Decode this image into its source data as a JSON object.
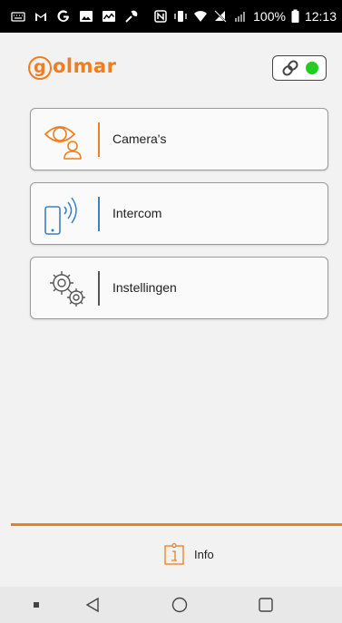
{
  "status_bar": {
    "battery_percent": "100%",
    "time": "12:13"
  },
  "header": {
    "logo_text": "olmar",
    "logo_initial": "g",
    "connection_status": "connected",
    "connection_color": "#22cc22"
  },
  "menu": {
    "items": [
      {
        "label": "Camera's",
        "icon": "camera-eye-user-icon",
        "accent": "#f07d1e"
      },
      {
        "label": "Intercom",
        "icon": "phone-signal-icon",
        "accent": "#3a7fc8"
      },
      {
        "label": "Instellingen",
        "icon": "gears-icon",
        "accent": "#555555"
      }
    ]
  },
  "footer": {
    "info_label": "Info",
    "accent": "#f07d1e"
  },
  "nav": {
    "items": [
      "menu-dot",
      "back",
      "home",
      "recents"
    ]
  }
}
